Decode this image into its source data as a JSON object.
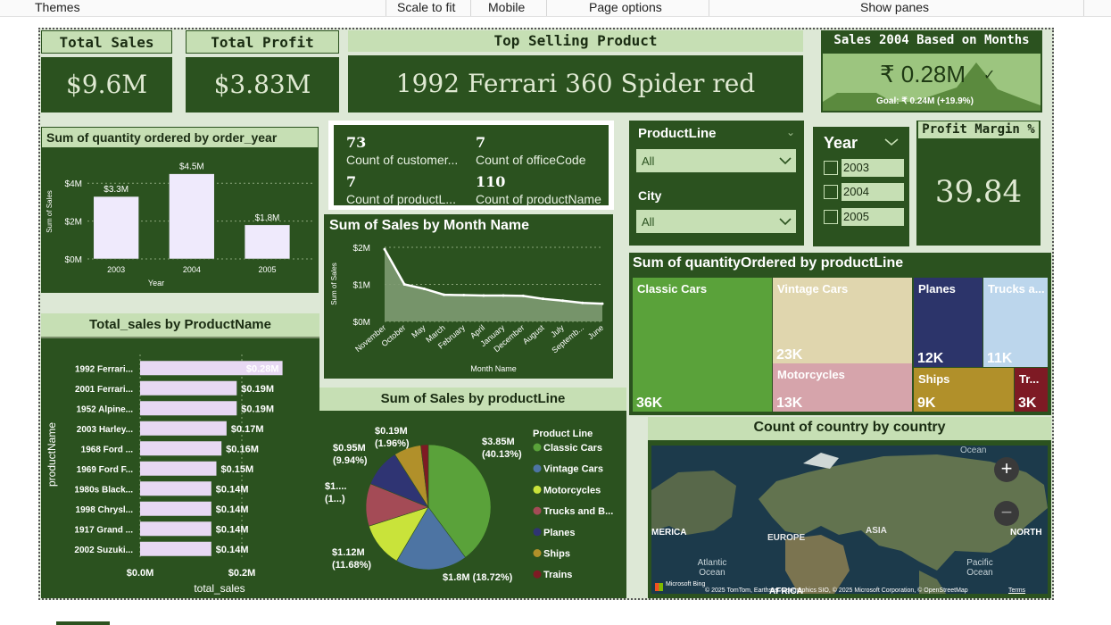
{
  "menu": [
    "Themes",
    "Scale to fit",
    "Mobile",
    "Page options",
    "Show panes"
  ],
  "kpis": {
    "total_sales": {
      "title": "Total Sales",
      "value": "$9.6M"
    },
    "total_profit": {
      "title": "Total Profit",
      "value": "$3.83M"
    },
    "top_product": {
      "title": "Top Selling Product",
      "value": "1992 Ferrari 360 Spider red"
    },
    "sales_2004": {
      "title": "Sales 2004 Based on Months",
      "value": "₹ 0.28M",
      "goal": "Goal: ₹ 0.24M (+19.9%)"
    },
    "profit_margin": {
      "title": "Profit Margin %",
      "value": "39.84"
    }
  },
  "cards": [
    {
      "value": "73",
      "label": "Count of customer..."
    },
    {
      "value": "7",
      "label": "Count of officeCode"
    },
    {
      "value": "7",
      "label": "Count of productL..."
    },
    {
      "value": "110",
      "label": "Count of productName"
    }
  ],
  "slicers": {
    "productline": {
      "label": "ProductLine",
      "value": "All"
    },
    "city": {
      "label": "City",
      "value": "All"
    },
    "year": {
      "label": "Year",
      "options": [
        "2003",
        "2004",
        "2005"
      ]
    }
  },
  "chart_data": [
    {
      "id": "qty_by_year",
      "type": "bar",
      "title": "Sum of quantity ordered by order_year",
      "xlabel": "Year",
      "ylabel": "Sum of Sales",
      "categories": [
        "2003",
        "2004",
        "2005"
      ],
      "values": [
        3.3,
        4.5,
        1.8
      ],
      "data_labels": [
        "$3.3M",
        "$4.5M",
        "$1.8M"
      ],
      "ylim": [
        0,
        5
      ],
      "yticks": [
        "$0M",
        "$2M",
        "$4M"
      ],
      "ytick_values": [
        0,
        2,
        4
      ]
    },
    {
      "id": "sales_by_month",
      "type": "area",
      "title": "Sum of Sales by Month Name",
      "xlabel": "Month Name",
      "ylabel": "Sum of Sales",
      "categories": [
        "November",
        "October",
        "May",
        "March",
        "February",
        "April",
        "January",
        "December",
        "August",
        "July",
        "Septemb...",
        "June"
      ],
      "values": [
        1.95,
        1.0,
        0.88,
        0.72,
        0.71,
        0.7,
        0.7,
        0.69,
        0.61,
        0.56,
        0.5,
        0.48
      ],
      "ylim": [
        0,
        2
      ],
      "yticks": [
        "$0M",
        "$1M",
        "$2M"
      ],
      "ytick_values": [
        0,
        1,
        2
      ]
    },
    {
      "id": "sales_by_product",
      "type": "bar",
      "orientation": "horizontal",
      "title": "Total_sales by ProductName",
      "xlabel": "total_sales",
      "ylabel": "productName",
      "categories": [
        "1992 Ferrari...",
        "2001 Ferrari...",
        "1952 Alpine...",
        "2003 Harley...",
        "1968 Ford ...",
        "1969 Ford F...",
        "1980s Black...",
        "1998 Chrysl...",
        "1917 Grand ...",
        "2002 Suzuki..."
      ],
      "values": [
        0.28,
        0.19,
        0.19,
        0.17,
        0.16,
        0.15,
        0.14,
        0.14,
        0.14,
        0.14
      ],
      "data_labels": [
        "$0.28M",
        "$0.19M",
        "$0.19M",
        "$0.17M",
        "$0.16M",
        "$0.15M",
        "$0.14M",
        "$0.14M",
        "$0.14M",
        "$0.14M"
      ],
      "xlim": [
        0,
        0.3
      ],
      "xticks": [
        "$0.0M",
        "$0.2M"
      ],
      "xtick_values": [
        0,
        0.2
      ]
    },
    {
      "id": "sales_by_productline",
      "type": "pie",
      "title": "Sum of Sales by productLine",
      "legend_title": "Product Line",
      "slices": [
        {
          "name": "Classic Cars",
          "value": 40.13,
          "label": "$3.85M (40.13%)",
          "color": "#5aa23a"
        },
        {
          "name": "Vintage Cars",
          "value": 18.72,
          "label": "$1.8M (18.72%)",
          "color": "#4d74a3"
        },
        {
          "name": "Motorcycles",
          "value": 11.68,
          "label": "$1.12M (11.68%)",
          "color": "#c9e33a"
        },
        {
          "name": "Trucks and B...",
          "value": 11.1,
          "label": "$1.... (1...)",
          "color": "#a44b56"
        },
        {
          "name": "Planes",
          "value": 9.94,
          "label": "$0.95M (9.94%)",
          "color": "#2f3473"
        },
        {
          "name": "Ships",
          "value": 7.11,
          "label": "",
          "color": "#b1902a"
        },
        {
          "name": "Trains",
          "value": 1.96,
          "label": "$0.19M (1.96%)",
          "color": "#7e1a24"
        }
      ]
    },
    {
      "id": "qty_by_productline",
      "type": "heatmap",
      "title": "Sum of quantityOrdered by productLine",
      "cells": [
        {
          "name": "Classic Cars",
          "value": "36K",
          "color": "#5aa23a"
        },
        {
          "name": "Vintage Cars",
          "value": "23K",
          "color": "#e0d6ae"
        },
        {
          "name": "Motorcycles",
          "value": "13K",
          "color": "#d6a4ab"
        },
        {
          "name": "Planes",
          "value": "12K",
          "color": "#2c346a"
        },
        {
          "name": "Trucks a...",
          "value": "11K",
          "color": "#bcd6ec"
        },
        {
          "name": "Ships",
          "value": "9K",
          "color": "#b1902a"
        },
        {
          "name": "Tr...",
          "value": "3K",
          "color": "#7e1a24"
        }
      ]
    }
  ],
  "map": {
    "title": "Count of country by country",
    "labels": [
      "Ocean",
      "MERICA",
      "EUROPE",
      "ASIA",
      "NORTH",
      "Atlantic Ocean",
      "Pacific Ocean",
      "AFRICA"
    ],
    "brand": "Microsoft Bing",
    "attribution": "© 2025 TomTom, Earthstar Geographics SIO, © 2025 Microsoft Corporation, © OpenStreetMap",
    "terms": "Terms"
  }
}
